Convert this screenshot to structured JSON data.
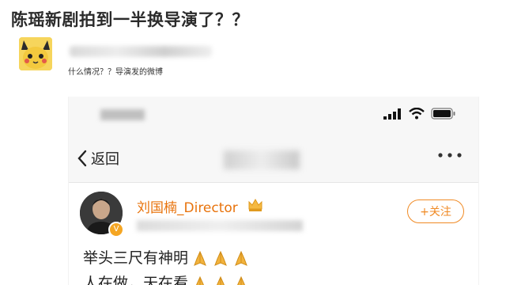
{
  "headline": "陈瑶新剧拍到一半换导演了？？",
  "post": {
    "caption": "什么情况？？导演发的微博"
  },
  "screenshot": {
    "nav": {
      "back_label": "返回"
    },
    "profile": {
      "username": "刘国楠_Director",
      "follow_label": "+关注"
    },
    "content": {
      "line1": "举头三尺有神明",
      "line2": "人在做，天在看"
    },
    "icons": {
      "pray": "folded-hands-icon",
      "crown": "crown-icon",
      "verified": "verified-icon"
    },
    "colors": {
      "accent": "#f08a24",
      "username": "#e8730c"
    }
  }
}
